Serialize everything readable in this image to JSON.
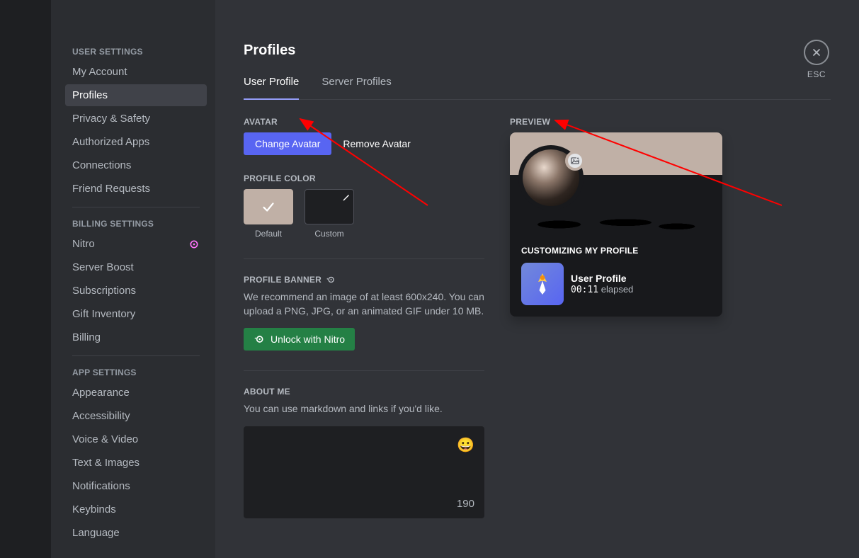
{
  "sidebar": {
    "sections": [
      {
        "header": "USER SETTINGS",
        "items": [
          {
            "label": "My Account"
          },
          {
            "label": "Profiles",
            "active": true
          },
          {
            "label": "Privacy & Safety"
          },
          {
            "label": "Authorized Apps"
          },
          {
            "label": "Connections"
          },
          {
            "label": "Friend Requests"
          }
        ]
      },
      {
        "header": "BILLING SETTINGS",
        "items": [
          {
            "label": "Nitro",
            "badge": "nitro"
          },
          {
            "label": "Server Boost"
          },
          {
            "label": "Subscriptions"
          },
          {
            "label": "Gift Inventory"
          },
          {
            "label": "Billing"
          }
        ]
      },
      {
        "header": "APP SETTINGS",
        "items": [
          {
            "label": "Appearance"
          },
          {
            "label": "Accessibility"
          },
          {
            "label": "Voice & Video"
          },
          {
            "label": "Text & Images"
          },
          {
            "label": "Notifications"
          },
          {
            "label": "Keybinds"
          },
          {
            "label": "Language"
          }
        ]
      }
    ]
  },
  "page": {
    "title": "Profiles",
    "tabs": [
      {
        "label": "User Profile",
        "active": true
      },
      {
        "label": "Server Profiles"
      }
    ],
    "avatar_section_label": "AVATAR",
    "change_avatar_button": "Change Avatar",
    "remove_avatar_button": "Remove Avatar",
    "profile_color_label": "PROFILE COLOR",
    "color_default_label": "Default",
    "color_custom_label": "Custom",
    "profile_banner_label": "PROFILE BANNER",
    "banner_desc": "We recommend an image of at least 600x240. You can upload a PNG, JPG, or an animated GIF under 10 MB.",
    "unlock_nitro_button": "Unlock with Nitro",
    "about_me_label": "ABOUT ME",
    "about_me_desc": "You can use markdown and links if you'd like.",
    "about_me_char_remaining": "190",
    "preview_label": "PREVIEW",
    "preview_customizing_label": "CUSTOMIZING MY PROFILE",
    "preview_activity_title": "User Profile",
    "preview_activity_time_value": "00:11",
    "preview_activity_time_suffix": " elapsed"
  },
  "close": {
    "esc_label": "ESC"
  }
}
